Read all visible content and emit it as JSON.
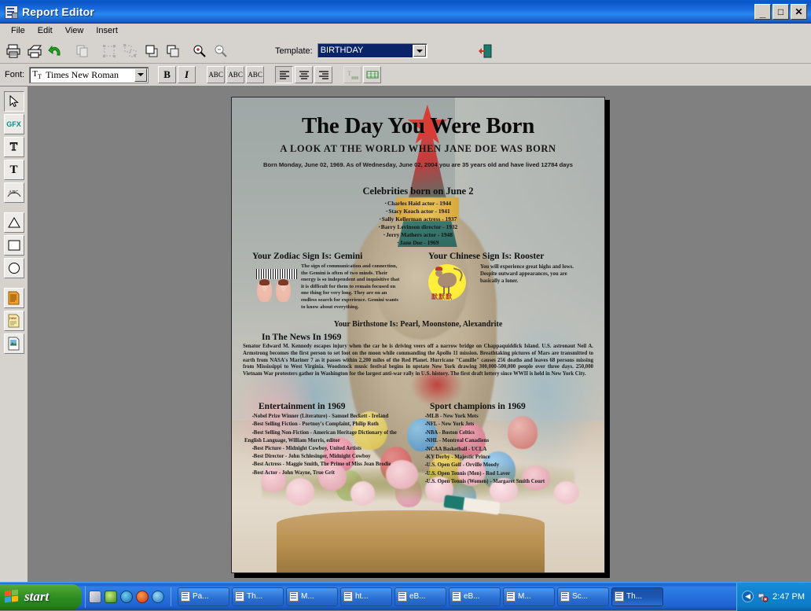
{
  "window": {
    "title": "Report Editor",
    "icon": "report-document-icon",
    "buttons": {
      "minimize": "_",
      "maximize": "□",
      "close": "✕"
    }
  },
  "menu": {
    "items": [
      "File",
      "Edit",
      "View",
      "Insert"
    ]
  },
  "toolbar": {
    "buttons": [
      {
        "name": "print-button",
        "icon": "printer-icon",
        "enabled": true
      },
      {
        "name": "print-preview-button",
        "icon": "print-preview-icon",
        "enabled": true
      },
      {
        "name": "undo-button",
        "icon": "undo-arrow-icon",
        "enabled": true
      },
      {
        "name": "copy-button",
        "icon": "copy-icon",
        "enabled": false
      },
      {
        "name": "group-button",
        "icon": "group-objects-icon",
        "enabled": false
      },
      {
        "name": "ungroup-button",
        "icon": "ungroup-objects-icon",
        "enabled": false
      },
      {
        "name": "bring-to-front-button",
        "icon": "bring-to-front-icon",
        "enabled": true
      },
      {
        "name": "send-to-back-button",
        "icon": "send-to-back-icon",
        "enabled": true
      },
      {
        "name": "zoom-in-button",
        "icon": "magnifier-plus-icon",
        "enabled": true
      },
      {
        "name": "zoom-out-button",
        "icon": "magnifier-minus-icon",
        "enabled": true
      }
    ],
    "template_label": "Template:",
    "template_value": "BIRTHDAY",
    "exit_button": "exit-door-icon"
  },
  "fontbar": {
    "font_label": "Font:",
    "font_value": "Times New Roman",
    "bold": "B",
    "italic": "I",
    "text_effects": [
      "ABC",
      "ABC",
      "ABC"
    ],
    "align": [
      "align-left",
      "align-center",
      "align-right"
    ],
    "frame_tools": [
      "text-frame-icon",
      "table-frame-icon"
    ]
  },
  "palette": {
    "tools": [
      {
        "name": "select-arrow-tool",
        "icon": "cursor-arrow-icon",
        "label": "",
        "selected": true
      },
      {
        "name": "graphic-tool",
        "icon": "gfx-icon",
        "label": "GFX"
      },
      {
        "name": "outline-text-tool",
        "icon": "outline-t-icon",
        "label": "T"
      },
      {
        "name": "bold-text-tool",
        "icon": "solid-t-icon",
        "label": "T"
      },
      {
        "name": "arc-text-tool",
        "icon": "abc-arc-icon",
        "label": "ABC"
      },
      {
        "name": "triangle-shape-tool",
        "icon": "triangle-icon"
      },
      {
        "name": "rectangle-shape-tool",
        "icon": "rectangle-icon"
      },
      {
        "name": "ellipse-shape-tool",
        "icon": "circle-icon"
      },
      {
        "name": "text-block-tool",
        "icon": "lined-page-icon"
      },
      {
        "name": "new-page-tool",
        "icon": "new-page-icon"
      },
      {
        "name": "image-page-tool",
        "icon": "image-page-icon"
      }
    ]
  },
  "document": {
    "title": "The Day You Were Born",
    "subtitle": "A LOOK AT THE WORLD WHEN JANE DOE WAS BORN",
    "born_line": "Born Monday, June 02, 1969. As of Wednesday, June 02, 2004 you are 35 years old and have lived 12784 days",
    "celebrities": {
      "heading": "Celebrities born on June 2",
      "items": [
        "Charles Haid actor - 1944",
        "Stacy Keach actor - 1941",
        "Sally Kellerman actress - 1937",
        "Barry Levinson director - 1932",
        "Jerry Mathers actor - 1948",
        "Jane Doe - 1969"
      ]
    },
    "zodiac": {
      "heading": "Your Zodiac Sign Is: Gemini",
      "image_label": "GEMINI",
      "text": "The sign of communication and connection, the Gemini is often of two minds.  Their energy is so independent and inquisitive that it is difficult for them to remain focused on one thing for very long.  They are on an endless search for experience.  Gemini wants to know about everything."
    },
    "chinese": {
      "heading": "Your Chinese Sign Is: Rooster",
      "text": "You will experience great highs and lows.  Despite outward appearances, you are basically a loner."
    },
    "birthstone": "Your Birthstone Is: Pearl, Moonstone, Alexandrite",
    "news": {
      "heading": "In The News In 1969",
      "text": "Senator Edward M. Kennedy escapes injury when the car he is driving veers off a narrow bridge on Chappaquiddick Island.  U.S. astronaut Neil A. Armstrong becomes the first person to set foot on the moon while commanding the Apollo 11 mission.  Breathtaking pictures of Mars are transmitted to earth from NASA's Mariner 7 as it passes within 2,200 miles of the Red Planet.  Hurricane \"Camille\" causes 256 deaths and leaves 68 persons missing from Mississippi to West Virginia.  Woodstock music festival begins in upstate New York drawing 300,000-500,000 people over three days.  250,000 Vietnam War protesters gather in Washington for the largest anti-war rally in U.S. history.  The first draft lottery since WWII is held in New York City."
    },
    "entertainment": {
      "heading": "Entertainment in 1969",
      "items": [
        "Nobel Prize Winner (Literature) - Samuel Beckett - Ireland",
        "Best Selling Fiction - Portnoy's Complaint, Philip Roth",
        "Best Selling Non-Fiction - American Heritage Dictionary of the English Language, William Morris, editor",
        "Best Picture - Midnight Cowboy, United Artists",
        "Best Director - John Schlesinger, Midnight Cowboy",
        "Best Actress - Maggie Smith, The Prime of Miss Jean Brodie",
        "Best Actor - John Wayne, True Grit"
      ]
    },
    "sports": {
      "heading": "Sport champions in 1969",
      "items": [
        "MLB - New York Mets",
        "NFL - New York Jets",
        "NBA - Boston Celtics",
        "NHL - Montreal Canadiens",
        "NCAA Basketball - UCLA",
        "KY Derby - Majestic Prince",
        "U.S. Open Golf - Orville Moody",
        "U.S. Open Tennis (Men) - Rod Laver",
        "U.S. Open Tennis (Women) - Margaret Smith Court"
      ]
    }
  },
  "taskbar": {
    "start": "start",
    "quick_launch": [
      "show-desktop-icon",
      "media-player-icon",
      "outlook-icon",
      "realplayer-icon",
      "internet-explorer-icon"
    ],
    "tasks": [
      {
        "label": "Pa...",
        "active": false
      },
      {
        "label": "Th...",
        "active": false
      },
      {
        "label": "M...",
        "active": false
      },
      {
        "label": "ht...",
        "active": false
      },
      {
        "label": "eB...",
        "active": false
      },
      {
        "label": "eB...",
        "active": false
      },
      {
        "label": "M...",
        "active": false
      },
      {
        "label": "Sc...",
        "active": false
      },
      {
        "label": "Th...",
        "active": true
      }
    ],
    "tray": {
      "expand": "◀",
      "icons": [
        "network-icon"
      ],
      "time": "2:47 PM"
    }
  },
  "colors": {
    "titlebar_blue": "#0a55c8",
    "taskbar_blue": "#1f63d2",
    "start_green": "#2f8c22",
    "chrome_gray": "#d6d3ce",
    "workspace_gray": "#808080",
    "selection_blue": "#0a246a"
  }
}
